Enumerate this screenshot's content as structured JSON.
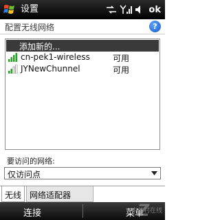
{
  "statusbar": {
    "title": "设置",
    "ok_label": "ok"
  },
  "subheader": {
    "title": "配置无线网络",
    "help": "?"
  },
  "networks": {
    "add_label": "添加新的...",
    "items": [
      {
        "name": "cn-pek1-wireless",
        "status": "可用",
        "signal_bars": 4
      },
      {
        "name": "JYNewChunnel",
        "status": "可用",
        "signal_bars": 2
      }
    ]
  },
  "access": {
    "label": "要访问的网络:",
    "selected": "仅访问点"
  },
  "tabs": {
    "items": [
      {
        "label": "无线"
      },
      {
        "label": "网络适配器"
      }
    ]
  },
  "softkeys": {
    "left": "连接",
    "right": "菜单"
  },
  "watermark": {
    "text": "中关村在线"
  },
  "colors": {
    "bar_dark": "#000000",
    "signal_green": "#1fa51f",
    "help_blue": "#1558c8"
  }
}
